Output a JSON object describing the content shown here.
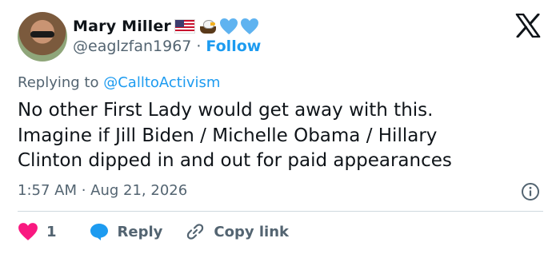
{
  "author": {
    "name": "Mary Miller",
    "handle": "@eaglzfan1967",
    "separator": "·",
    "follow_label": "Follow",
    "emoji_icons": [
      "us-flag-icon",
      "eagle-icon",
      "blue-heart-icon",
      "blue-heart-icon"
    ]
  },
  "reply_context": {
    "prefix": "Replying to",
    "mention": "@CalltoActivism"
  },
  "tweet": {
    "lines": [
      "No other First Lady would get away with this.",
      "Imagine if Jill Biden / Michelle Obama / Hillary",
      "Clinton dipped in and out for paid appearances"
    ],
    "timestamp": "1:57 AM · Aug 21, 2026"
  },
  "actions": {
    "like_count": "1",
    "reply_label": "Reply",
    "copy_link_label": "Copy link"
  },
  "colors": {
    "accent": "#1d9bf0",
    "like": "#f91880",
    "secondary_text": "#536471",
    "divider": "#cfd9de"
  }
}
